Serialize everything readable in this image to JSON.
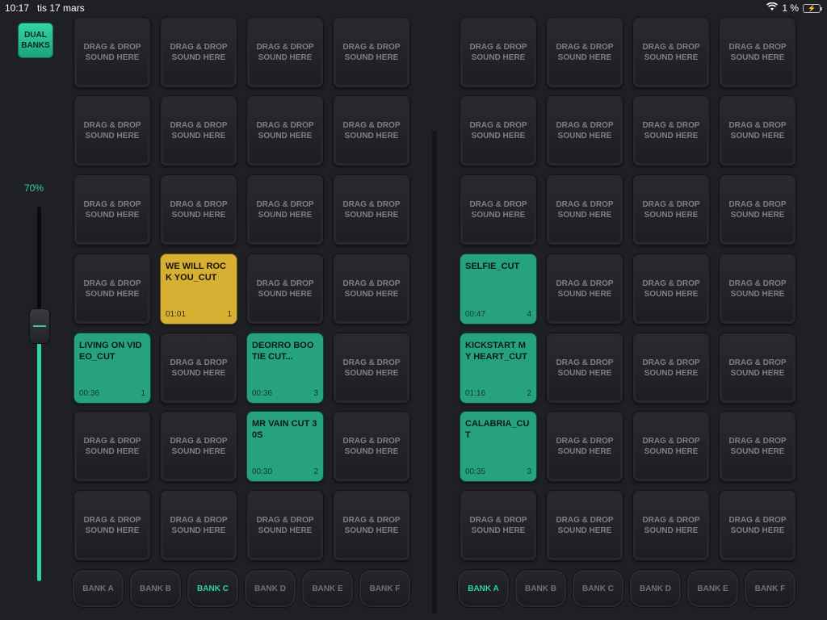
{
  "status": {
    "time": "10:17",
    "date": "tis 17 mars",
    "battery": "1 %"
  },
  "dual_banks_label": "DUAL\nBANKS",
  "volume": {
    "label": "70%",
    "level": 0.7
  },
  "empty_pad": {
    "line1": "DRAG & DROP",
    "line2": "SOUND HERE"
  },
  "colors": {
    "accent": "#2fd3a1",
    "pad_green": "#26a37c",
    "pad_yellow": "#d7b033"
  },
  "left_bank": {
    "tabs": [
      "BANK A",
      "BANK B",
      "BANK C",
      "BANK D",
      "BANK E",
      "BANK F"
    ],
    "active_tab": 2,
    "pads": [
      {
        "row": 3,
        "col": 1,
        "name": "WE WILL ROCK YOU_CUT",
        "time": "01:01",
        "count": "1",
        "color": "yellow"
      },
      {
        "row": 4,
        "col": 0,
        "name": "LIVING ON VIDEO_CUT",
        "time": "00:36",
        "count": "1",
        "color": "green"
      },
      {
        "row": 4,
        "col": 2,
        "name": "DEORRO BOOTIE CUT...",
        "time": "00:36",
        "count": "3",
        "color": "green"
      },
      {
        "row": 5,
        "col": 2,
        "name": "MR VAIN CUT 30S",
        "time": "00:30",
        "count": "2",
        "color": "green"
      }
    ]
  },
  "right_bank": {
    "tabs": [
      "BANK A",
      "BANK B",
      "BANK C",
      "BANK D",
      "BANK E",
      "BANK F"
    ],
    "active_tab": 0,
    "pads": [
      {
        "row": 3,
        "col": 0,
        "name": "SELFIE_CUT",
        "time": "00:47",
        "count": "4",
        "color": "green"
      },
      {
        "row": 4,
        "col": 0,
        "name": "KICKSTART MY HEART_CUT",
        "time": "01:16",
        "count": "2",
        "color": "green"
      },
      {
        "row": 5,
        "col": 0,
        "name": "CALABRIA_CUT",
        "time": "00:35",
        "count": "3",
        "color": "green"
      }
    ]
  }
}
